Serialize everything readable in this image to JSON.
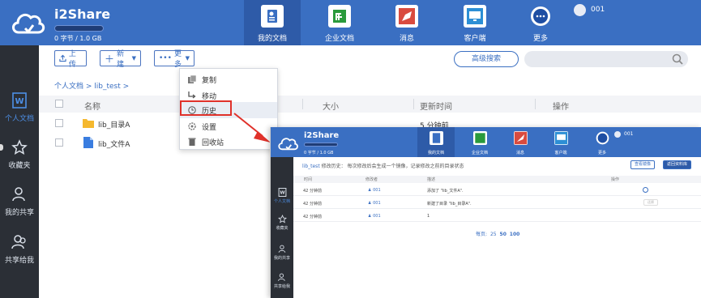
{
  "app": {
    "name": "i2Share",
    "quota": "0 字节 / 1.0 GB",
    "user": "001"
  },
  "nav": [
    {
      "label": "我的文档",
      "icon": "my-docs-icon",
      "active": true
    },
    {
      "label": "企业文档",
      "icon": "enterprise-docs-icon",
      "active": false
    },
    {
      "label": "消息",
      "icon": "rocket-icon",
      "active": false
    },
    {
      "label": "客户端",
      "icon": "monitor-icon",
      "active": false
    },
    {
      "label": "更多",
      "icon": "more-icon",
      "active": false
    }
  ],
  "sidebar": [
    {
      "label": "个人文档",
      "icon": "word-doc-icon",
      "active": true
    },
    {
      "label": "收藏夹",
      "icon": "star-icon",
      "active": false
    },
    {
      "label": "我的共享",
      "icon": "user-share-icon",
      "active": false
    },
    {
      "label": "共享给我",
      "icon": "users-icon",
      "active": false
    }
  ],
  "toolbar": {
    "upload": "上传",
    "new": "新建",
    "more": "更多",
    "advanced_search": "高级搜索"
  },
  "breadcrumb": "个人文档 > lib_test >",
  "table": {
    "columns": [
      "名称",
      "大小",
      "更新时间",
      "操作"
    ],
    "rows": [
      {
        "name": "lib_目录A",
        "icon": "folder-icon",
        "time": "5 分钟前"
      },
      {
        "name": "lib_文件A",
        "icon": "file-icon",
        "time": ""
      }
    ]
  },
  "dropdown": [
    {
      "label": "复制",
      "icon": "copy-icon"
    },
    {
      "label": "移动",
      "icon": "move-icon"
    },
    {
      "label": "历史",
      "icon": "clock-icon"
    },
    {
      "label": "设置",
      "icon": "settings-icon"
    },
    {
      "label": "回收站",
      "icon": "trash-icon"
    }
  ],
  "inset": {
    "app_name": "i2Share",
    "quota": "0 字节 / 1.0 GB",
    "user": "001",
    "nav": [
      "我的文档",
      "企业文档",
      "消息",
      "客户端",
      "更多"
    ],
    "sidebar": [
      "个人文档",
      "收藏夹",
      "我的共享",
      "共享给我"
    ],
    "history_lib": "lib_test",
    "history_text": " 修改历史：  每次修改后会生成一个镜像，记录修改之前的目录状态",
    "btn_view_image": "查看镜像",
    "btn_back": "返回资料库",
    "columns": [
      "时间",
      "修改者",
      "描述",
      "操作"
    ],
    "rows": [
      {
        "time": "42 分钟前",
        "user": "001",
        "desc": "添加了 \"lib_文件A\"."
      },
      {
        "time": "42 分钟前",
        "user": "001",
        "desc": "新建了目录 \"lib_目录A\"."
      },
      {
        "time": "42 分钟前",
        "user": "001",
        "desc": "1"
      }
    ],
    "restore": "还原",
    "pager_label": "每页:",
    "pager_options": [
      "25",
      "50",
      "100"
    ]
  },
  "colors": {
    "header": "#3a6fc2",
    "sidebar": "#2b2f36",
    "highlight": "#e0312a"
  }
}
